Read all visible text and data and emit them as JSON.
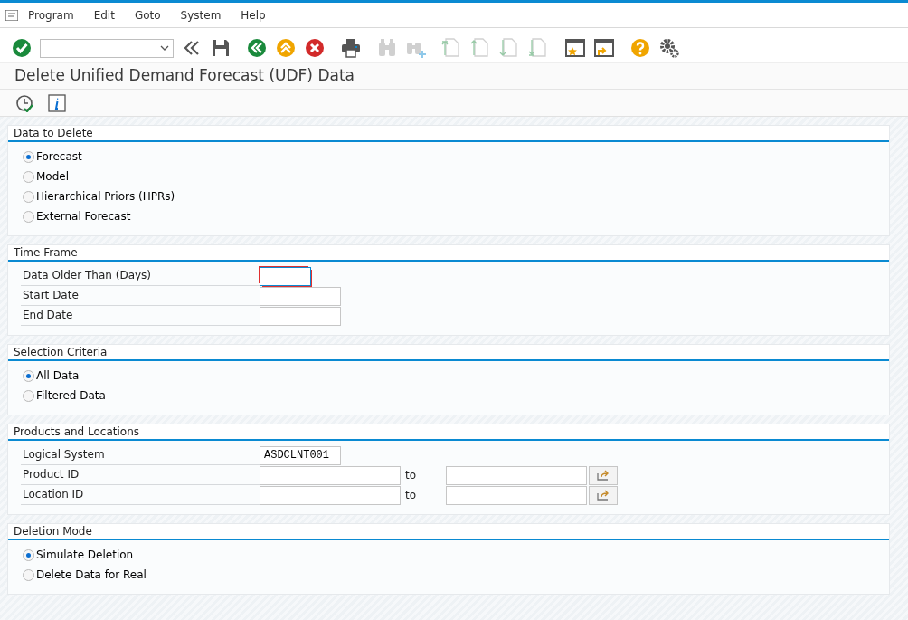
{
  "menu": [
    "Program",
    "Edit",
    "Goto",
    "System",
    "Help"
  ],
  "toolbar": [
    {
      "kind": "enter",
      "disabled": false
    },
    {
      "kind": "command-field",
      "disabled": false
    },
    {
      "kind": "collapse",
      "disabled": false
    },
    {
      "kind": "save",
      "disabled": false
    },
    {
      "kind": "back",
      "disabled": false
    },
    {
      "kind": "exit",
      "disabled": false
    },
    {
      "kind": "cancel",
      "disabled": false
    },
    {
      "kind": "print",
      "disabled": false
    },
    {
      "kind": "find",
      "disabled": true
    },
    {
      "kind": "find-next",
      "disabled": true
    },
    {
      "kind": "first-page",
      "disabled": true
    },
    {
      "kind": "previous-page",
      "disabled": true
    },
    {
      "kind": "next-page",
      "disabled": true
    },
    {
      "kind": "last-page",
      "disabled": true
    },
    {
      "kind": "new-session",
      "disabled": false
    },
    {
      "kind": "shortcut",
      "disabled": false
    },
    {
      "kind": "help",
      "disabled": false
    },
    {
      "kind": "settings",
      "disabled": false
    }
  ],
  "title": "Delete Unified Demand Forecast (UDF) Data",
  "app_toolbar": [
    {
      "kind": "execute"
    },
    {
      "kind": "info"
    }
  ],
  "sections": [
    {
      "title": "Data to Delete",
      "kind": "radios",
      "options": [
        {
          "label": "Forecast",
          "selected": true
        },
        {
          "label": "Model",
          "selected": false
        },
        {
          "label": "Hierarchical Priors (HPRs)",
          "selected": false
        },
        {
          "label": "External Forecast",
          "selected": false
        }
      ]
    },
    {
      "title": "Time Frame",
      "kind": "fields",
      "rows": [
        {
          "label": "Data Older Than (Days)",
          "value": "",
          "focused": true
        },
        {
          "label": "Start Date",
          "value": "",
          "focused": false
        },
        {
          "label": "End Date",
          "value": "",
          "focused": false
        }
      ]
    },
    {
      "title": "Selection Criteria",
      "kind": "radios",
      "options": [
        {
          "label": "All Data",
          "selected": true
        },
        {
          "label": "Filtered Data",
          "selected": false
        }
      ]
    },
    {
      "title": "Products and Locations",
      "kind": "fields",
      "rows": [
        {
          "label": "Logical System",
          "value": "ASDCLNT001",
          "focused": false
        },
        {
          "label": "Product ID",
          "value": "",
          "focused": false,
          "range_label": "to",
          "range_value": ""
        },
        {
          "label": "Location ID",
          "value": "",
          "focused": false,
          "range_label": "to",
          "range_value": ""
        }
      ]
    },
    {
      "title": "Deletion Mode",
      "kind": "radios",
      "options": [
        {
          "label": "Simulate Deletion",
          "selected": true
        },
        {
          "label": "Delete Data for Real",
          "selected": false
        }
      ]
    }
  ]
}
